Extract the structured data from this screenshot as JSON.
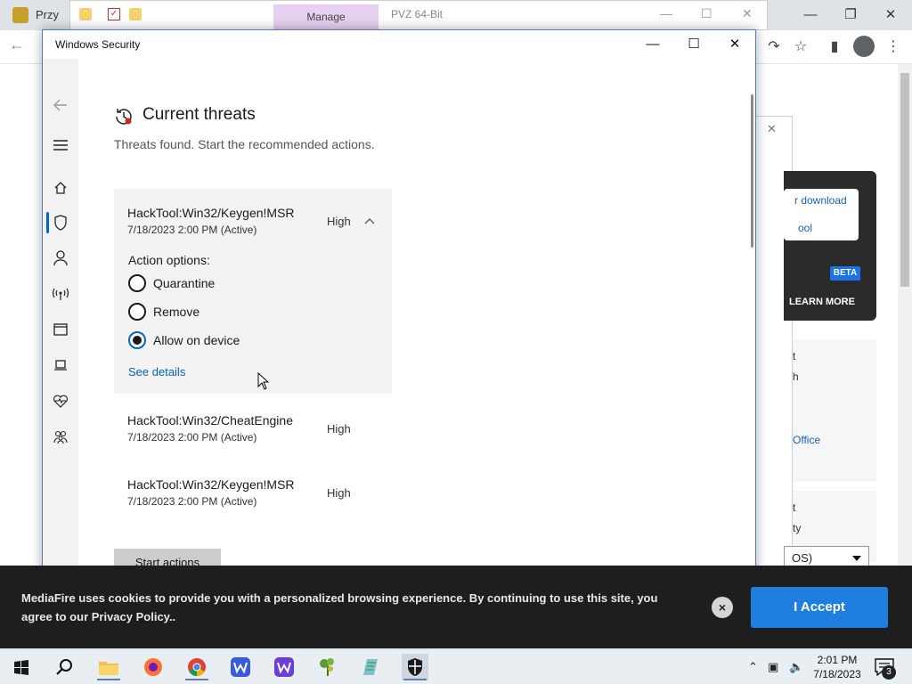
{
  "browser": {
    "tab_title": "Przy",
    "explorer_manage_tab": "Manage",
    "explorer_title": "PVZ 64-Bit"
  },
  "mediafire_page": {
    "promo_link_1": "r download",
    "promo_link_2": "ool",
    "beta_badge": "BETA",
    "learn_more": "LEARN MORE",
    "card1_fragment_1": "t",
    "card1_fragment_2": "h",
    "card1_link": "Office",
    "card2_fragment_1": "t",
    "card2_fragment_2": "ty",
    "select_value": "OS)"
  },
  "windows_security": {
    "title": "Windows Security",
    "page_title": "Current threats",
    "subtitle": "Threats found. Start the recommended actions.",
    "action_options_label": "Action options:",
    "options": [
      {
        "label": "Quarantine",
        "selected": false
      },
      {
        "label": "Remove",
        "selected": false
      },
      {
        "label": "Allow on device",
        "selected": true
      }
    ],
    "see_details": "See details",
    "threats": [
      {
        "name": "HackTool:Win32/Keygen!MSR",
        "date": "7/18/2023 2:00 PM (Active)",
        "severity": "High",
        "expanded": true
      },
      {
        "name": "HackTool:Win32/CheatEngine",
        "date": "7/18/2023 2:00 PM (Active)",
        "severity": "High",
        "expanded": false
      },
      {
        "name": "HackTool:Win32/Keygen!MSR",
        "date": "7/18/2023 2:00 PM (Active)",
        "severity": "High",
        "expanded": false
      }
    ],
    "start_actions": "Start actions",
    "sidebar_icons": [
      "back-arrow-icon",
      "hamburger-menu-icon",
      "home-icon",
      "shield-icon",
      "person-icon",
      "wifi-antenna-icon",
      "app-browser-icon",
      "laptop-icon",
      "heart-health-icon",
      "family-icon",
      "gear-icon"
    ],
    "accent_color": "#0067c0"
  },
  "cookie_banner": {
    "text": "MediaFire uses cookies to provide you with a personalized browsing experience. By continuing to use this site, you agree to our Privacy Policy..",
    "accept_label": "I Accept",
    "close_label": "×",
    "accept_color": "#1f7fe0"
  },
  "taskbar": {
    "apps": [
      "windows-start-icon",
      "search-icon",
      "file-explorer-icon",
      "firefox-icon",
      "chrome-icon",
      "app-w-icon",
      "app-w-purple-icon",
      "plant-game-icon",
      "notepad-icon",
      "windows-security-icon"
    ],
    "time": "2:01 PM",
    "date": "7/18/2023",
    "notification_count": "3"
  }
}
